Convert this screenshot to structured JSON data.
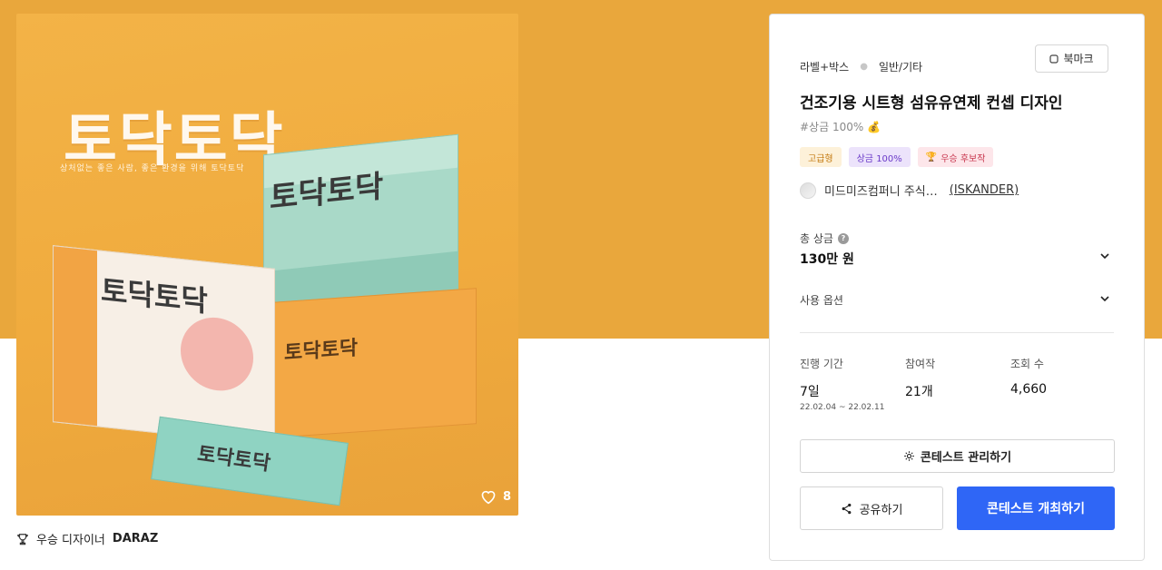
{
  "colors": {
    "accent": "#2f66f6",
    "hero_bg": "#e9a73c"
  },
  "product_image": {
    "title_text": "토닥토닥",
    "tagline": "상처없는 좋은 사람, 좋은 환경을 위해 토닥토닥",
    "likes": "8",
    "icon": "heart-outline-icon"
  },
  "winner": {
    "prefix": "우승 디자이너",
    "name": "DARAZ",
    "icon": "trophy-icon"
  },
  "panel": {
    "category": "라벨+박스",
    "subcategory": "일반/기타",
    "bookmark_label": "북마크",
    "title": "건조기용 시트형 섬유유연제 컨셉 디자인",
    "subtitle": "#상금 100% 💰",
    "badges": [
      {
        "label": "고급형"
      },
      {
        "label": "상금 100%"
      },
      {
        "label": "우승 후보작",
        "icon": "trophy-icon"
      }
    ],
    "company": "미드미즈컴퍼니 주식…",
    "username": "(ISKANDER)",
    "prize_label": "총 상금",
    "prize_value": "130만 원",
    "usage_label": "사용 옵션",
    "stats": [
      {
        "label": "진행 기간",
        "value": "7일",
        "range": "22.02.04 ~ 22.02.11"
      },
      {
        "label": "참여작",
        "value": "21개"
      },
      {
        "label": "조회 수",
        "value": "4,660"
      }
    ],
    "manage_label": "콘테스트 관리하기",
    "share_label": "공유하기",
    "host_label": "콘테스트 개최하기"
  }
}
